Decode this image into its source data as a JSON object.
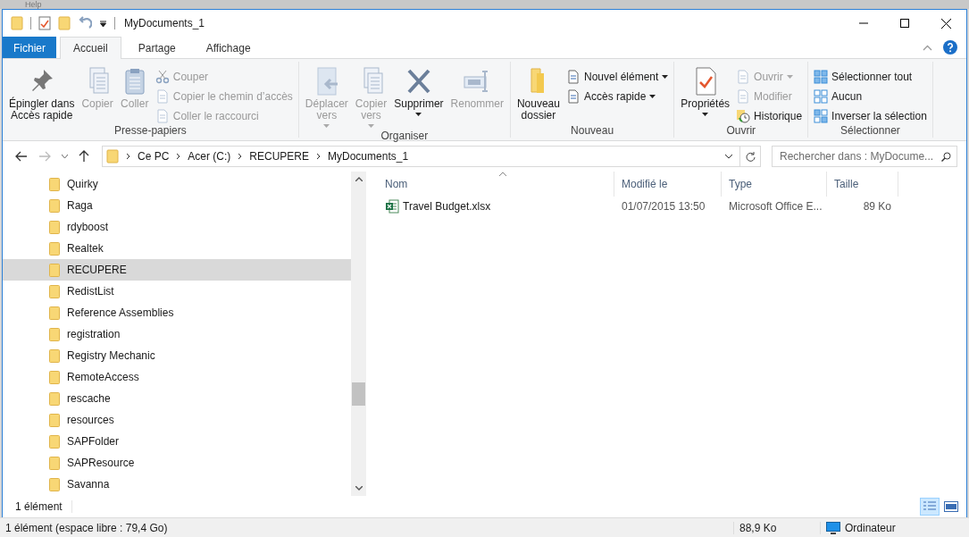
{
  "background_app": {
    "menu_text": "Help"
  },
  "window": {
    "title": "MyDocuments_1"
  },
  "ribbon": {
    "tabs": [
      {
        "label": "Fichier",
        "kind": "file",
        "selected": false
      },
      {
        "label": "Accueil",
        "kind": "tab",
        "selected": true
      },
      {
        "label": "Partage",
        "kind": "tab",
        "selected": false
      },
      {
        "label": "Affichage",
        "kind": "tab",
        "selected": false
      }
    ],
    "groups": [
      {
        "label": "Presse-papiers",
        "items": [
          {
            "label": "Épingler dans\nAccès rapide",
            "kind": "large",
            "disabled": false,
            "dropdown": false
          },
          {
            "label": "Copier",
            "kind": "large",
            "disabled": true,
            "dropdown": false
          },
          {
            "label": "Coller",
            "kind": "large",
            "disabled": true,
            "dropdown": false
          },
          {
            "label": "Couper",
            "kind": "small",
            "disabled": true,
            "dropdown": false
          },
          {
            "label": "Copier le chemin d’accès",
            "kind": "small",
            "disabled": true,
            "dropdown": false
          },
          {
            "label": "Coller le raccourci",
            "kind": "small",
            "disabled": true,
            "dropdown": false
          }
        ]
      },
      {
        "label": "Organiser",
        "items": [
          {
            "label": "Déplacer\nvers",
            "kind": "large",
            "disabled": true,
            "dropdown": true
          },
          {
            "label": "Copier\nvers",
            "kind": "large",
            "disabled": true,
            "dropdown": true
          },
          {
            "label": "Supprimer",
            "kind": "large",
            "disabled": false,
            "dropdown": true
          },
          {
            "label": "Renommer",
            "kind": "large",
            "disabled": true,
            "dropdown": false
          }
        ]
      },
      {
        "label": "Nouveau",
        "items": [
          {
            "label": "Nouveau\ndossier",
            "kind": "large",
            "disabled": false,
            "dropdown": false
          },
          {
            "label": "Nouvel élément",
            "kind": "small",
            "disabled": false,
            "dropdown": true
          },
          {
            "label": "Accès rapide",
            "kind": "small",
            "disabled": false,
            "dropdown": true
          }
        ]
      },
      {
        "label": "Ouvrir",
        "items": [
          {
            "label": "Propriétés",
            "kind": "large",
            "disabled": false,
            "dropdown": true
          },
          {
            "label": "Ouvrir",
            "kind": "small",
            "disabled": true,
            "dropdown": true
          },
          {
            "label": "Modifier",
            "kind": "small",
            "disabled": true,
            "dropdown": false
          },
          {
            "label": "Historique",
            "kind": "small",
            "disabled": false,
            "dropdown": false
          }
        ]
      },
      {
        "label": "Sélectionner",
        "items": [
          {
            "label": "Sélectionner tout",
            "kind": "small",
            "disabled": false,
            "dropdown": false
          },
          {
            "label": "Aucun",
            "kind": "small",
            "disabled": false,
            "dropdown": false
          },
          {
            "label": "Inverser la sélection",
            "kind": "small",
            "disabled": false,
            "dropdown": false
          }
        ]
      }
    ]
  },
  "address_bar": {
    "path": [
      "Ce PC",
      "Acer (C:)",
      "RECUPERE",
      "MyDocuments_1"
    ],
    "search": {
      "placeholder": "Rechercher dans : MyDocume..."
    }
  },
  "nav_tree": {
    "items": [
      {
        "label": "Quirky",
        "selected": false
      },
      {
        "label": "Raga",
        "selected": false
      },
      {
        "label": "rdyboost",
        "selected": false
      },
      {
        "label": "Realtek",
        "selected": false
      },
      {
        "label": "RECUPERE",
        "selected": true
      },
      {
        "label": "RedistList",
        "selected": false
      },
      {
        "label": "Reference Assemblies",
        "selected": false
      },
      {
        "label": "registration",
        "selected": false
      },
      {
        "label": "Registry Mechanic",
        "selected": false
      },
      {
        "label": "RemoteAccess",
        "selected": false
      },
      {
        "label": "rescache",
        "selected": false
      },
      {
        "label": "resources",
        "selected": false
      },
      {
        "label": "SAPFolder",
        "selected": false
      },
      {
        "label": "SAPResource",
        "selected": false
      },
      {
        "label": "Savanna",
        "selected": false
      }
    ]
  },
  "file_list": {
    "columns": [
      "Nom",
      "Modifié le",
      "Type",
      "Taille"
    ],
    "rows": [
      {
        "name": "Travel Budget.xlsx",
        "modified": "01/07/2015 13:50",
        "type": "Microsoft Office E...",
        "size": "89 Ko",
        "selected": false
      }
    ]
  },
  "details_bar": {
    "count": "1 élément",
    "views": [
      {
        "kind": "details",
        "selected": true
      },
      {
        "kind": "tiles",
        "selected": false
      }
    ]
  },
  "status_bar": {
    "free_space": "1 élément (espace libre : 79,4 Go)",
    "size": "88,9 Ko",
    "location": "Ordinateur"
  }
}
